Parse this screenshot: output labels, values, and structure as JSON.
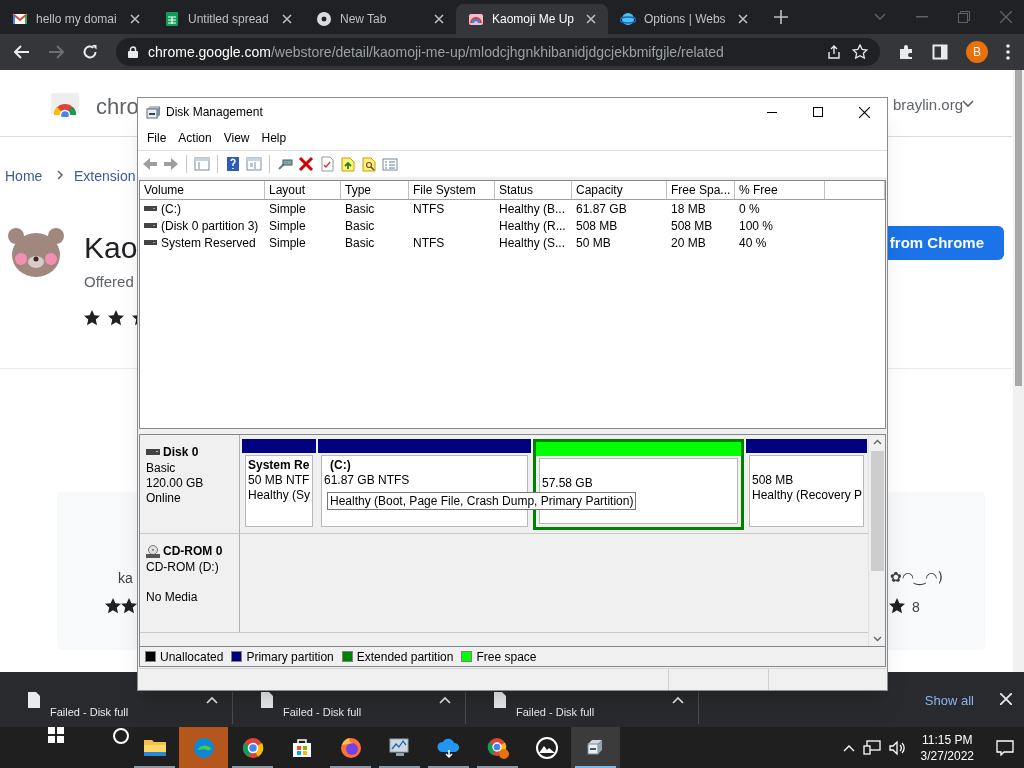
{
  "browser": {
    "tabs": [
      {
        "title": "hello my domai",
        "selected": false
      },
      {
        "title": "Untitled spread",
        "selected": false
      },
      {
        "title": "New Tab",
        "selected": false
      },
      {
        "title": "Kaomoji Me Up",
        "selected": true
      },
      {
        "title": "Options | Webs",
        "selected": false
      }
    ],
    "address": {
      "host": "chrome.google.com",
      "path": "/webstore/detail/kaomoji-me-up/mlodcjhgnkhibanidjdgcjekbmifgjle/related"
    },
    "profile": "B"
  },
  "webstore": {
    "logo_text": "chro",
    "account": "braylin.org",
    "breadcrumb": [
      "Home",
      "Extension"
    ],
    "title": "Kao",
    "offered": "Offered",
    "action_button": "from Chrome",
    "card_left_title": "ka",
    "card_right_title": "✿◠‿◠)",
    "card_right_count": "8"
  },
  "window": {
    "title": "Disk Management",
    "menu": [
      "File",
      "Action",
      "View",
      "Help"
    ],
    "volumes": {
      "columns": [
        "Volume",
        "Layout",
        "Type",
        "File System",
        "Status",
        "Capacity",
        "Free Spa...",
        "% Free"
      ],
      "rows": [
        {
          "volume": "(C:)",
          "layout": "Simple",
          "type": "Basic",
          "file_system": "NTFS",
          "status": "Healthy (B...",
          "capacity": "61.87 GB",
          "free_space": "18 MB",
          "percent_free": "0 %"
        },
        {
          "volume": "(Disk 0 partition 3)",
          "layout": "Simple",
          "type": "Basic",
          "status": "Healthy (R...",
          "capacity": "508 MB",
          "free_space": "508 MB",
          "percent_free": "100 %"
        },
        {
          "volume": "System Reserved",
          "layout": "Simple",
          "type": "Basic",
          "file_system": "NTFS",
          "status": "Healthy (S...",
          "capacity": "50 MB",
          "free_space": "20 MB",
          "percent_free": "40 %"
        }
      ]
    },
    "disks": [
      {
        "kind": "disk",
        "name": "Disk 0",
        "type": "Basic",
        "size": "120.00 GB",
        "status": "Online",
        "partitions": [
          {
            "kind": "primary",
            "name": "System Re",
            "size": "50 MB NTF",
            "status": "Healthy (Sy"
          },
          {
            "kind": "primary",
            "name": "(C:)",
            "size": "61.87 GB NTFS"
          },
          {
            "kind": "free",
            "size": "57.58 GB"
          },
          {
            "kind": "primary",
            "size": "508 MB",
            "status": "Healthy (Recovery P"
          }
        ]
      },
      {
        "kind": "cdrom",
        "name": "CD-ROM 0",
        "type": "CD-ROM (D:)",
        "status": "No Media"
      }
    ],
    "tooltip": "Healthy (Boot, Page File, Crash Dump, Primary Partition)",
    "legend": [
      {
        "label": "Unallocated",
        "color": "#000000"
      },
      {
        "label": "Primary partition",
        "color": "#000080"
      },
      {
        "label": "Extended partition",
        "color": "#008000"
      },
      {
        "label": "Free space",
        "color": "#00ff00"
      }
    ]
  },
  "downloads": {
    "items": [
      {
        "status": "Failed - Disk full"
      },
      {
        "status": "Failed - Disk full"
      },
      {
        "status": "Failed - Disk full"
      }
    ],
    "show_all": "Show all"
  },
  "taskbar": {
    "apps": [
      {
        "kind": "folder",
        "running": true,
        "flashing": false,
        "active": false
      },
      {
        "kind": "edge",
        "running": false,
        "flashing": true,
        "active": false
      },
      {
        "kind": "chrome",
        "running": true,
        "flashing": false,
        "active": false
      },
      {
        "kind": "store",
        "running": false,
        "flashing": false,
        "active": false
      },
      {
        "kind": "firefox",
        "running": true,
        "flashing": false,
        "active": false
      },
      {
        "kind": "monitor",
        "running": true,
        "flashing": false,
        "active": false
      },
      {
        "kind": "cloud",
        "running": true,
        "flashing": false,
        "active": false
      },
      {
        "kind": "chromeprofile",
        "running": true,
        "flashing": false,
        "active": false
      },
      {
        "kind": "mountain",
        "running": false,
        "flashing": false,
        "active": false
      },
      {
        "kind": "diskmgmt",
        "running": true,
        "flashing": false,
        "active": true
      }
    ],
    "time": "11:15 PM",
    "date": "3/27/2022"
  }
}
